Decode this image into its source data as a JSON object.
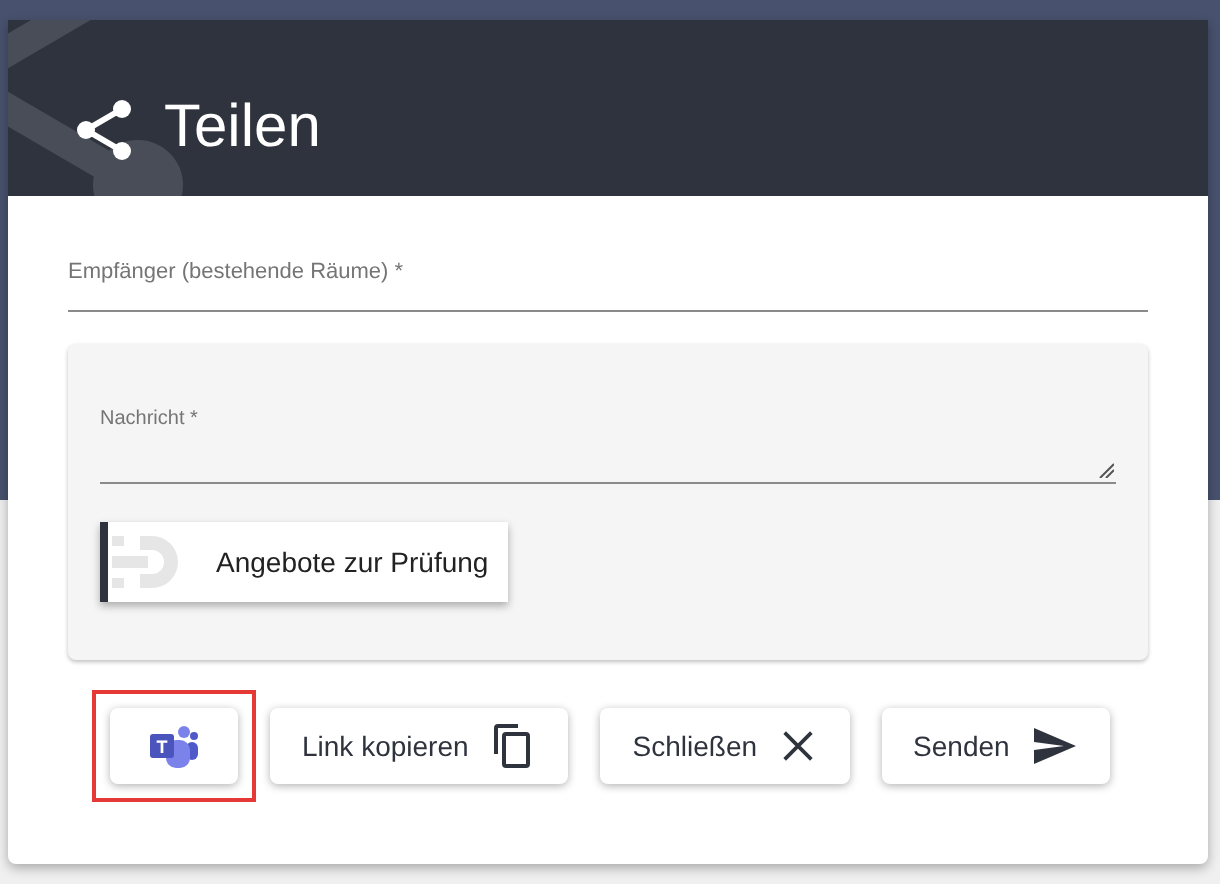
{
  "dialog": {
    "title": "Teilen"
  },
  "recipient_field": {
    "label": "Empfänger (bestehende Räume) *"
  },
  "message_panel": {
    "message_field": {
      "label": "Nachricht *"
    },
    "attachment": {
      "label": "Angebote zur Prüfung"
    }
  },
  "buttons": [
    {
      "kind": "teams",
      "logo_letter": "T",
      "highlighted": true
    },
    {
      "kind": "copy",
      "label": "Link kopieren",
      "highlighted": false
    },
    {
      "kind": "close",
      "label": "Schließen",
      "highlighted": false
    },
    {
      "kind": "send",
      "label": "Senden",
      "highlighted": false
    }
  ]
}
